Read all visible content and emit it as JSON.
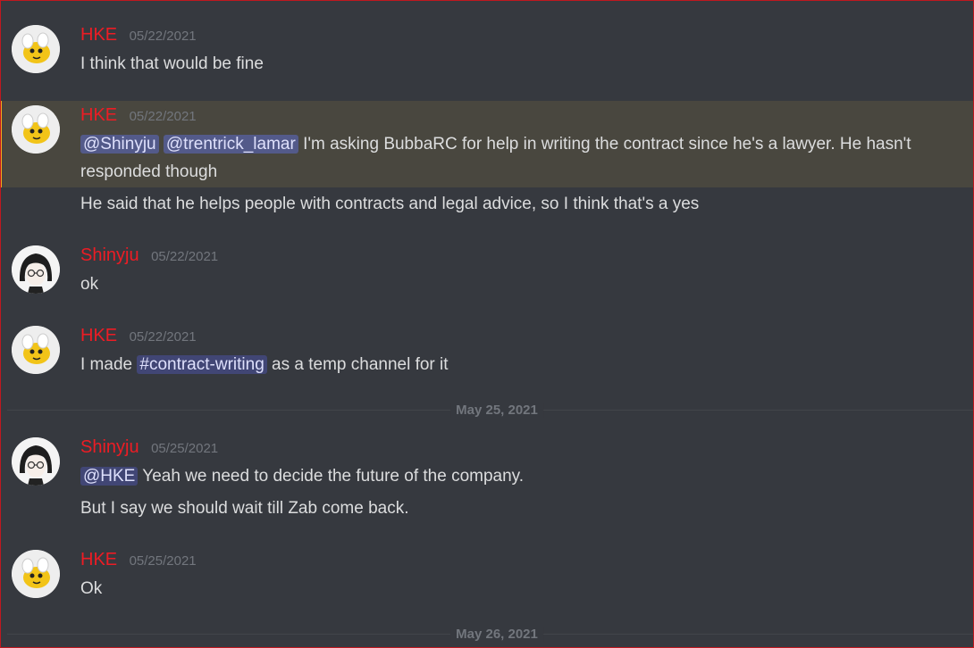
{
  "messages": [
    {
      "author": "HKE",
      "timestamp": "05/22/2021",
      "lines": [
        "I think that would be fine"
      ],
      "avatar": "bee-avatar"
    },
    {
      "author": "HKE",
      "timestamp": "05/22/2021",
      "mention1": "@Shinyju",
      "mention2": "@trentrick_lamar",
      "text_main": " I'm asking BubbaRC for help in writing the contract since he's a lawyer. He hasn't responded though",
      "followup": "He said that he helps people with contracts and legal advice, so I think that's a yes",
      "avatar": "bee-avatar"
    },
    {
      "author": "Shinyju",
      "timestamp": "05/22/2021",
      "lines": [
        "ok"
      ],
      "avatar": "anime-avatar"
    },
    {
      "author": "HKE",
      "timestamp": "05/22/2021",
      "prefix": "I made ",
      "channel": "#contract-writing",
      "suffix": " as a temp channel for it",
      "avatar": "bee-avatar"
    },
    {
      "author": "Shinyju",
      "timestamp": "05/25/2021",
      "mention": "@HKE",
      "text_main": " Yeah we need to decide the future of the company.",
      "followup": "But I say we should wait till Zab come back.",
      "avatar": "anime-avatar"
    },
    {
      "author": "HKE",
      "timestamp": "05/25/2021",
      "lines": [
        "Ok"
      ],
      "avatar": "bee-avatar"
    }
  ],
  "dividers": [
    "May 25, 2021",
    "May 26, 2021"
  ],
  "colors": {
    "background": "#36393f",
    "author": "#ed1c24",
    "mention_bg": "#414675",
    "highlight_bg": "#49473f"
  }
}
